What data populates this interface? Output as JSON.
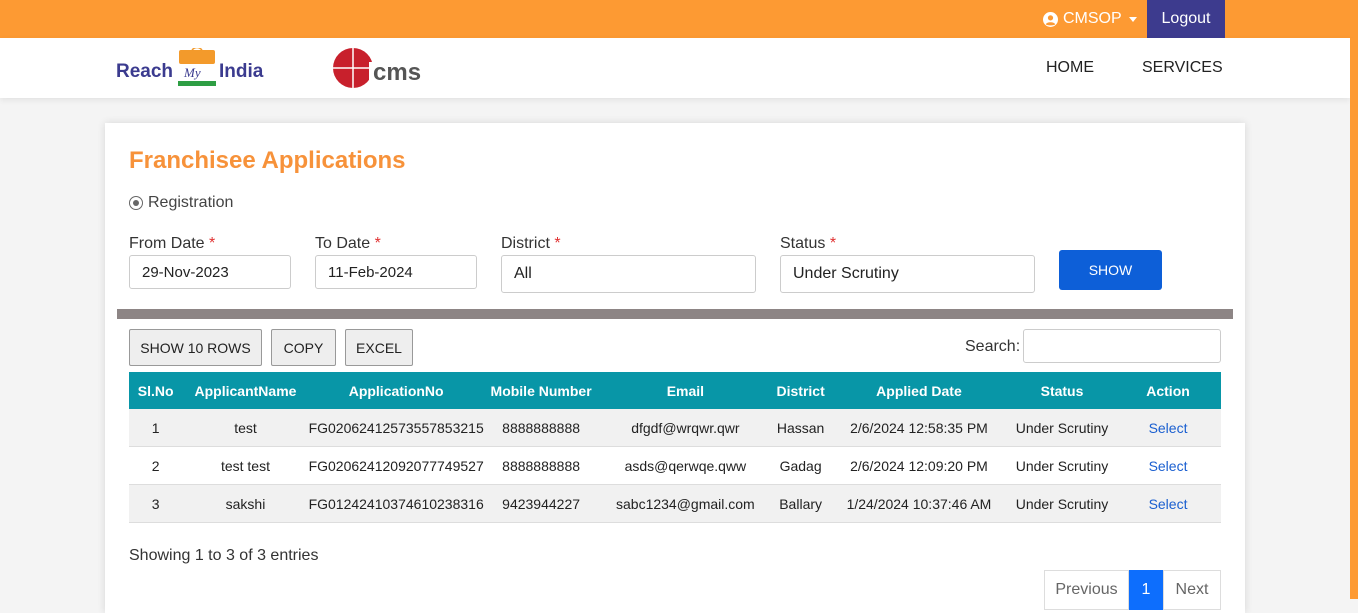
{
  "header": {
    "user_label": "CMSOP",
    "logout_label": "Logout",
    "brand_reach": "Reach",
    "brand_my": "My",
    "brand_india": "India",
    "brand_cms": "cms",
    "nav": {
      "home": "HOME",
      "services": "SERVICES"
    },
    "colors": {
      "topbar": "#fd9a33",
      "logout": "#3d3b8e"
    }
  },
  "page": {
    "title": "Franchisee Applications",
    "radio_label": "Registration",
    "radio_selected": true
  },
  "filters": {
    "from_date": {
      "label": "From Date",
      "value": "29-Nov-2023"
    },
    "to_date": {
      "label": "To Date",
      "value": "11-Feb-2024"
    },
    "district": {
      "label": "District",
      "value": "All"
    },
    "status": {
      "label": "Status",
      "value": "Under Scrutiny"
    },
    "required_mark": "*",
    "show_button": "SHOW"
  },
  "toolbar": {
    "show_rows": "SHOW 10 ROWS",
    "copy": "COPY",
    "excel": "EXCEL",
    "search_label": "Search:",
    "search_value": ""
  },
  "table": {
    "headers": [
      "Sl.No",
      "ApplicantName",
      "ApplicationNo",
      "Mobile Number",
      "Email",
      "District",
      "Applied Date",
      "Status",
      "Action"
    ],
    "rows": [
      [
        "1",
        "test",
        "FG02062412573557853215",
        "8888888888",
        "dfgdf@wrqwr.qwr",
        "Hassan",
        "2/6/2024 12:58:35 PM",
        "Under Scrutiny",
        "Select"
      ],
      [
        "2",
        "test test",
        "FG02062412092077749527",
        "8888888888",
        "asds@qerwqe.qww",
        "Gadag",
        "2/6/2024 12:09:20 PM",
        "Under Scrutiny",
        "Select"
      ],
      [
        "3",
        "sakshi",
        "FG01242410374610238316",
        "9423944227",
        "sabc1234@gmail.com",
        "Ballary",
        "1/24/2024 10:37:46 AM",
        "Under Scrutiny",
        "Select"
      ]
    ],
    "header_color": "#0896a7"
  },
  "footer": {
    "info": "Showing 1 to 3 of 3 entries",
    "pagination": {
      "previous": "Previous",
      "current": "1",
      "next": "Next"
    }
  }
}
